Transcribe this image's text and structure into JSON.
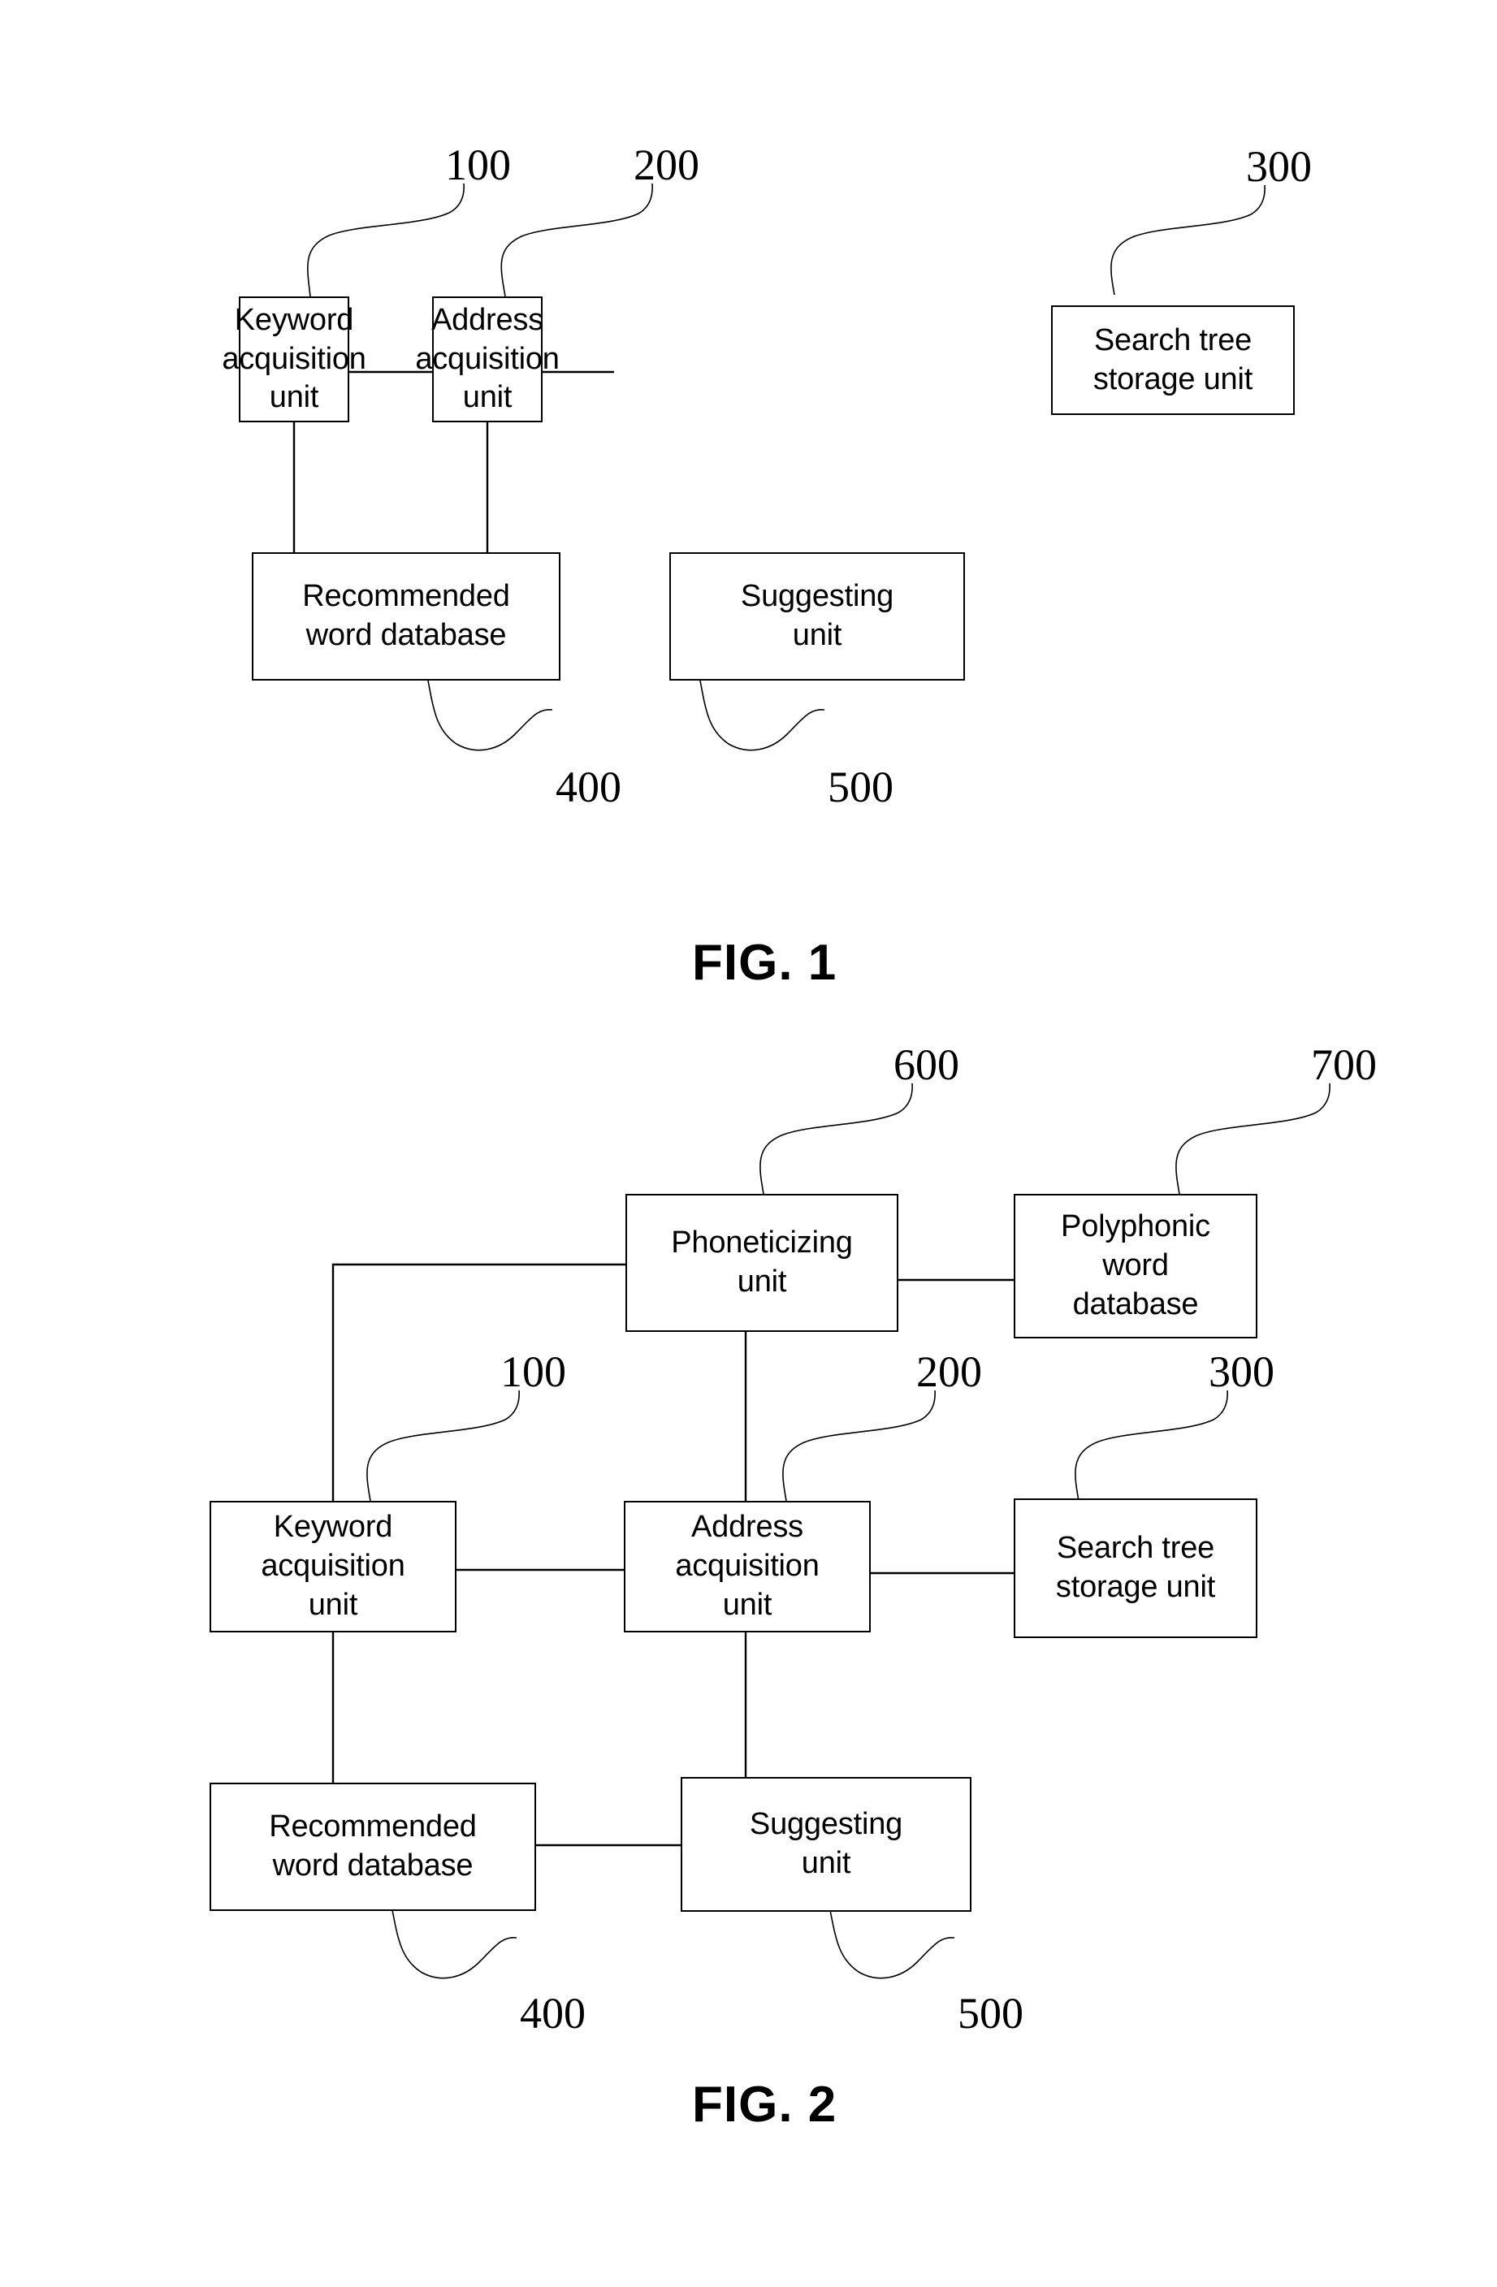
{
  "document": {
    "type": "patent-drawing-sheet",
    "background_color": "#ffffff",
    "line_color": "#000000"
  },
  "figures": [
    {
      "id": "fig1",
      "caption": "FIG. 1",
      "nodes": [
        {
          "key": "keyword",
          "label": "Keyword acquisition unit",
          "lines": [
            "Keyword",
            "acquisition",
            "unit"
          ],
          "ref": "100"
        },
        {
          "key": "address",
          "label": "Address acquisition unit",
          "lines": [
            "Address",
            "acquisition",
            "unit"
          ],
          "ref": "200"
        },
        {
          "key": "searchtree",
          "label": "Search tree storage unit",
          "lines": [
            "Search tree",
            "storage unit"
          ],
          "ref": "300"
        },
        {
          "key": "recommended",
          "label": "Recommended word database",
          "lines": [
            "Recommended",
            "word database"
          ],
          "ref": "400"
        },
        {
          "key": "suggesting",
          "label": "Suggesting unit",
          "lines": [
            "Suggesting",
            "unit"
          ],
          "ref": "500"
        }
      ],
      "connections": [
        {
          "from": "keyword",
          "to": "address"
        },
        {
          "from": "address",
          "to": "searchtree"
        },
        {
          "from": "keyword",
          "to": "recommended"
        },
        {
          "from": "address",
          "to": "suggesting"
        },
        {
          "from": "recommended",
          "to": "suggesting"
        }
      ]
    },
    {
      "id": "fig2",
      "caption": "FIG. 2",
      "nodes": [
        {
          "key": "phoneticizing",
          "label": "Phoneticizing unit",
          "lines": [
            "Phoneticizing",
            "unit"
          ],
          "ref": "600"
        },
        {
          "key": "polyphonic",
          "label": "Polyphonic word database",
          "lines": [
            "Polyphonic",
            "word",
            "database"
          ],
          "ref": "700"
        },
        {
          "key": "keyword",
          "label": "Keyword acquisition unit",
          "lines": [
            "Keyword",
            "acquisition",
            "unit"
          ],
          "ref": "100"
        },
        {
          "key": "address",
          "label": "Address acquisition unit",
          "lines": [
            "Address",
            "acquisition",
            "unit"
          ],
          "ref": "200"
        },
        {
          "key": "searchtree",
          "label": "Search tree storage unit",
          "lines": [
            "Search tree",
            "storage unit"
          ],
          "ref": "300"
        },
        {
          "key": "recommended",
          "label": "Recommended word database",
          "lines": [
            "Recommended",
            "word database"
          ],
          "ref": "400"
        },
        {
          "key": "suggesting",
          "label": "Suggesting unit",
          "lines": [
            "Suggesting",
            "unit"
          ],
          "ref": "500"
        }
      ],
      "connections": [
        {
          "from": "phoneticizing",
          "to": "polyphonic"
        },
        {
          "from": "phoneticizing",
          "to": "keyword"
        },
        {
          "from": "phoneticizing",
          "to": "address"
        },
        {
          "from": "keyword",
          "to": "address"
        },
        {
          "from": "address",
          "to": "searchtree"
        },
        {
          "from": "keyword",
          "to": "recommended"
        },
        {
          "from": "address",
          "to": "suggesting"
        },
        {
          "from": "recommended",
          "to": "suggesting"
        }
      ]
    }
  ],
  "fig1": {
    "caption": "FIG. 1",
    "keyword": {
      "l1": "Keyword",
      "l2": "acquisition",
      "l3": "unit"
    },
    "address": {
      "l1": "Address",
      "l2": "acquisition",
      "l3": "unit"
    },
    "searchtree": {
      "l1": "Search tree",
      "l2": "storage unit"
    },
    "recommended": {
      "l1": "Recommended",
      "l2": "word database"
    },
    "suggesting": {
      "l1": "Suggesting",
      "l2": "unit"
    },
    "ref100": "100",
    "ref200": "200",
    "ref300": "300",
    "ref400": "400",
    "ref500": "500"
  },
  "fig2": {
    "caption": "FIG. 2",
    "phoneticizing": {
      "l1": "Phoneticizing",
      "l2": "unit"
    },
    "polyphonic": {
      "l1": "Polyphonic",
      "l2": "word",
      "l3": "database"
    },
    "keyword": {
      "l1": "Keyword",
      "l2": "acquisition",
      "l3": "unit"
    },
    "address": {
      "l1": "Address",
      "l2": "acquisition",
      "l3": "unit"
    },
    "searchtree": {
      "l1": "Search tree",
      "l2": "storage unit"
    },
    "recommended": {
      "l1": "Recommended",
      "l2": "word database"
    },
    "suggesting": {
      "l1": "Suggesting",
      "l2": "unit"
    },
    "ref100": "100",
    "ref200": "200",
    "ref300": "300",
    "ref400": "400",
    "ref500": "500",
    "ref600": "600",
    "ref700": "700"
  }
}
